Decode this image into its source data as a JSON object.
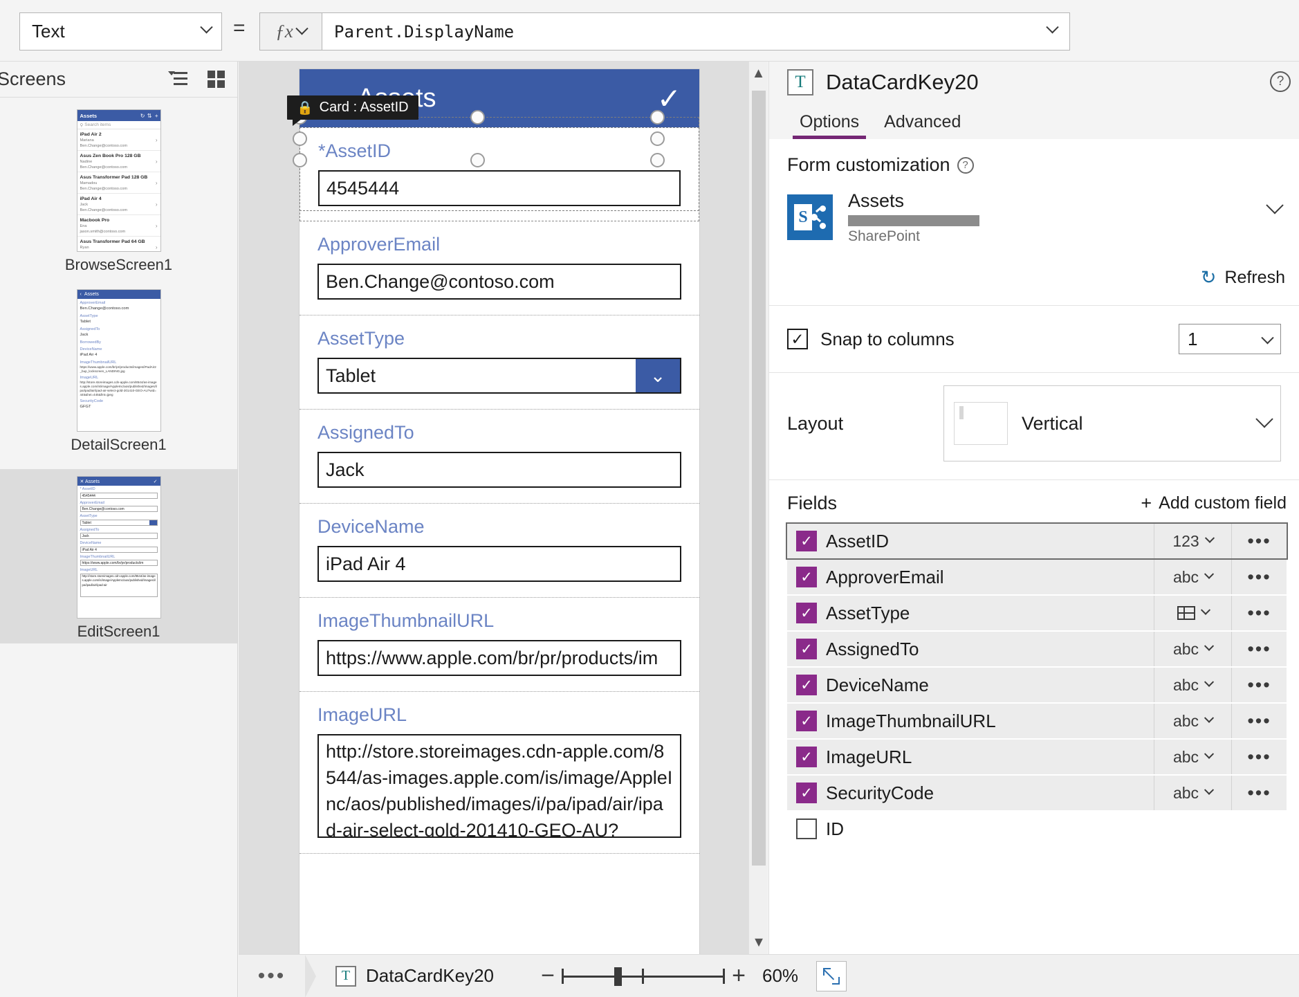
{
  "formula_bar": {
    "property_value": "Text",
    "equals": "=",
    "fx_label": "fx",
    "formula": "Parent.DisplayName"
  },
  "sidebar": {
    "title": "Screens",
    "icons": {
      "tree_view": "tree-view-icon",
      "thumbnail_view": "thumbnail-view-icon"
    },
    "screens": [
      {
        "label": "BrowseScreen1",
        "selected": false,
        "thumb": {
          "header_title": "Assets",
          "search_placeholder": "Search items",
          "rows": [
            {
              "title": "iPad Air 2",
              "sub1": "Mariana",
              "sub2": "Ben.Change@contoso.com"
            },
            {
              "title": "Asus Zen Book Pro 128 GB",
              "sub1": "Nadine",
              "sub2": "Ben.Change@contoso.com"
            },
            {
              "title": "Asus Transformer Pad 128 GB",
              "sub1": "Mamadou",
              "sub2": "Ben.Change@contoso.com"
            },
            {
              "title": "iPad Air 4",
              "sub1": "Jack",
              "sub2": "Ben.Change@contoso.com"
            },
            {
              "title": "Macbook Pro",
              "sub1": "Ena",
              "sub2": "jason.smith@contoso.com"
            },
            {
              "title": "Asus Transformer Pad 64 GB",
              "sub1": "Ryan",
              "sub2": "jason.smith@contoso.com"
            }
          ]
        }
      },
      {
        "label": "DetailScreen1",
        "selected": false,
        "thumb": {
          "header_title": "Assets",
          "fields": [
            {
              "label": "ApproverEmail",
              "value": "Ben.Change@contoso.com"
            },
            {
              "label": "AssetType",
              "value": "Tablet"
            },
            {
              "label": "AssignedTo",
              "value": "Jack"
            },
            {
              "label": "BorrowedBy",
              "value": ""
            },
            {
              "label": "DeviceName",
              "value": "iPad Air 4"
            },
            {
              "label": "ImageThumbnailURL",
              "value": "https://www.apple.com/br/pr/products/images/iPadAir2_bup_lockscreen_LANDING.jpg"
            },
            {
              "label": "ImageURL",
              "value": "http://store.storeimages.cdn-apple.com/8544/as-images.apple.com/is/image/AppleInc/aos/published/images/i/pa/ipad/air/ipad-air-select-gold-201410-GEO-AU?wid=445&hei=445&fmt=jpeg"
            },
            {
              "label": "SecurityCode",
              "value": "GFGT"
            }
          ]
        }
      },
      {
        "label": "EditScreen1",
        "selected": true,
        "thumb": {
          "header_title": "Assets",
          "fields": [
            {
              "label": "* AssetID",
              "value": "4545444",
              "kind": "text"
            },
            {
              "label": "ApproverEmail",
              "value": "Ben.Change@contoso.com",
              "kind": "text"
            },
            {
              "label": "AssetType",
              "value": "Tablet",
              "kind": "dropdown"
            },
            {
              "label": "AssignedTo",
              "value": "Jack",
              "kind": "text"
            },
            {
              "label": "DeviceName",
              "value": "iPad Air 4",
              "kind": "text"
            },
            {
              "label": "ImageThumbnailURL",
              "value": "https://www.apple.com/br/pr/products/im",
              "kind": "text"
            },
            {
              "label": "ImageURL",
              "value": "http://store.storeimages.cdn-apple.com/8544/as-images.apple.com/is/image/AppleInc/aos/published/images/i/pa/ipad/air/ipad-air",
              "kind": "area"
            }
          ]
        }
      }
    ]
  },
  "canvas": {
    "app_header": {
      "close_icon": "chevron-down-icon",
      "title": "Assets",
      "accept_icon": "check-icon"
    },
    "tooltip": {
      "lock_icon": "lock-icon",
      "text": "Card : AssetID"
    },
    "cards": [
      {
        "label": "AssetID",
        "required": true,
        "value": "4545444",
        "kind": "text",
        "selected": true
      },
      {
        "label": "ApproverEmail",
        "required": false,
        "value": "Ben.Change@contoso.com",
        "kind": "text",
        "selected": false
      },
      {
        "label": "AssetType",
        "required": false,
        "value": "Tablet",
        "kind": "dropdown",
        "selected": false
      },
      {
        "label": "AssignedTo",
        "required": false,
        "value": "Jack",
        "kind": "text",
        "selected": false
      },
      {
        "label": "DeviceName",
        "required": false,
        "value": "iPad Air 4",
        "kind": "text",
        "selected": false
      },
      {
        "label": "ImageThumbnailURL",
        "required": false,
        "value": "https://www.apple.com/br/pr/products/im",
        "kind": "text",
        "selected": false
      },
      {
        "label": "ImageURL",
        "required": false,
        "value": "http://store.storeimages.cdn-apple.com/8544/as-images.apple.com/is/image/AppleInc/aos/published/images/i/pa/ipad/air/ipad-air-select-gold-201410-GEO-AU?",
        "kind": "area",
        "selected": false
      }
    ]
  },
  "right_panel": {
    "icon": "text-control-icon",
    "icon_glyph": "T",
    "title": "DataCardKey20",
    "help_icon": "help-icon",
    "tabs": [
      {
        "label": "Options",
        "active": true
      },
      {
        "label": "Advanced",
        "active": false
      }
    ],
    "form_customization": {
      "title": "Form customization",
      "datasource": {
        "name": "Assets",
        "type": "SharePoint",
        "icon": "sharepoint-icon",
        "redacted": true
      },
      "refresh_label": "Refresh",
      "refresh_icon": "refresh-icon"
    },
    "snap_to_columns": {
      "label": "Snap to columns",
      "checked": true,
      "columns_value": "1"
    },
    "layout": {
      "label": "Layout",
      "value": "Vertical"
    },
    "fields": {
      "title": "Fields",
      "add_label": "Add custom field",
      "items": [
        {
          "name": "AssetID",
          "checked": true,
          "type": "123",
          "type_icon": "number-icon",
          "selected": true
        },
        {
          "name": "ApproverEmail",
          "checked": true,
          "type": "abc",
          "type_icon": "text-icon",
          "selected": false
        },
        {
          "name": "AssetType",
          "checked": true,
          "type": "",
          "type_icon": "choice-icon",
          "selected": false
        },
        {
          "name": "AssignedTo",
          "checked": true,
          "type": "abc",
          "type_icon": "text-icon",
          "selected": false
        },
        {
          "name": "DeviceName",
          "checked": true,
          "type": "abc",
          "type_icon": "text-icon",
          "selected": false
        },
        {
          "name": "ImageThumbnailURL",
          "checked": true,
          "type": "abc",
          "type_icon": "text-icon",
          "selected": false
        },
        {
          "name": "ImageURL",
          "checked": true,
          "type": "abc",
          "type_icon": "text-icon",
          "selected": false
        },
        {
          "name": "SecurityCode",
          "checked": true,
          "type": "abc",
          "type_icon": "text-icon",
          "selected": false
        },
        {
          "name": "ID",
          "checked": false,
          "type": "",
          "type_icon": "",
          "selected": false
        }
      ],
      "more_label": "•••"
    }
  },
  "status_bar": {
    "more_label": "•••",
    "breadcrumb_icon": "text-control-icon",
    "breadcrumb_glyph": "T",
    "breadcrumb_name": "DataCardKey20",
    "zoom_out": "−",
    "zoom_in": "+",
    "zoom_percent": "60%",
    "fit_icon": "fit-to-screen-icon"
  }
}
